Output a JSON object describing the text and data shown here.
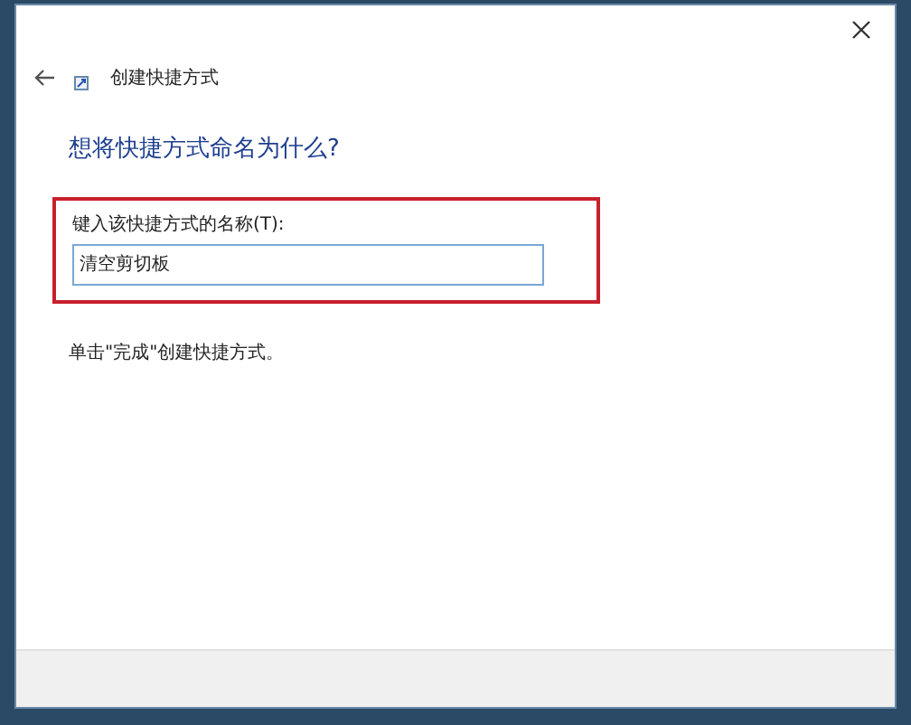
{
  "window": {
    "title": "创建快捷方式"
  },
  "heading": "想将快捷方式命名为什么?",
  "name_field": {
    "label": "键入该快捷方式的名称(T):",
    "value": "清空剪切板",
    "highlighted": true
  },
  "hint": "单击\"完成\"创建快捷方式。"
}
